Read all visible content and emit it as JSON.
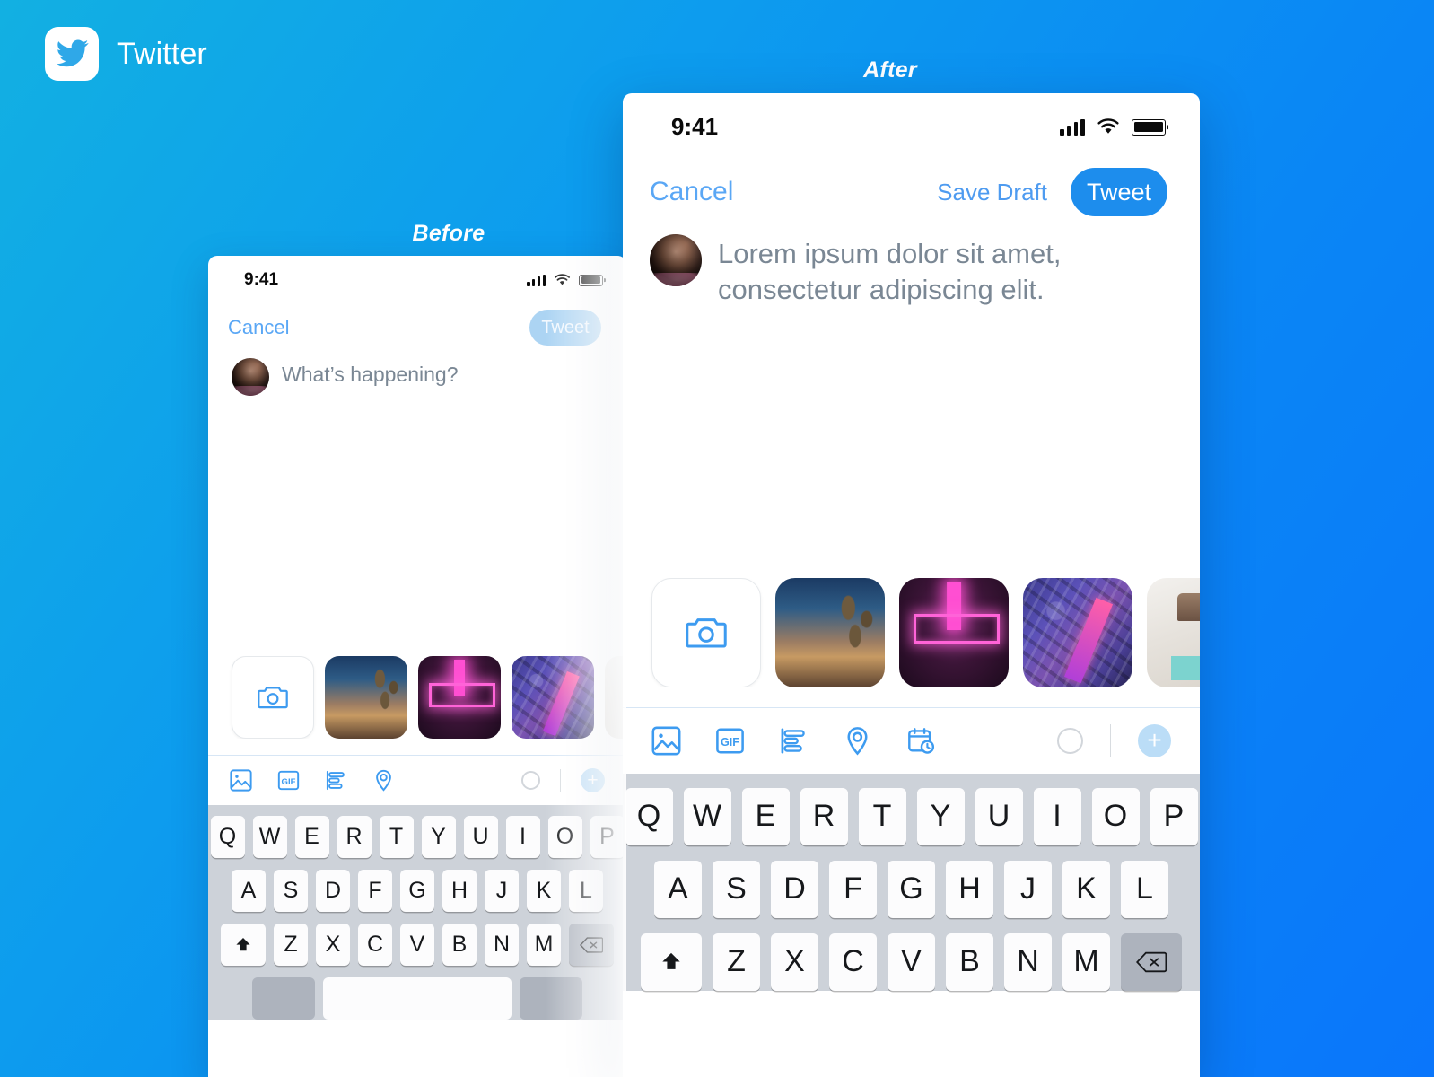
{
  "brand": {
    "name": "Twitter",
    "logo_icon": "twitter-bird-icon",
    "logo_bg": "#FFFFFF",
    "bird_color": "#2FA8E8"
  },
  "background": {
    "gradient_from": "#12B0E2",
    "gradient_to": "#0A76FB"
  },
  "captions": {
    "before": "Before",
    "after": "After"
  },
  "before": {
    "status_bar": {
      "time": "9:41",
      "signal_icon": "cellular-signal-icon",
      "wifi_icon": "wifi-icon",
      "battery_icon": "battery-icon"
    },
    "nav": {
      "cancel_label": "Cancel",
      "tweet_label": "Tweet",
      "tweet_enabled": false,
      "tweet_disabled_color": "#ACD4F3"
    },
    "compose": {
      "avatar_icon": "user-avatar",
      "placeholder": "What’s happening?"
    },
    "media": {
      "camera_icon": "camera-icon",
      "thumbnails": [
        "photo-teepee-desert",
        "photo-neon-portrait",
        "photo-aerial-city",
        "photo-white-lamp"
      ]
    },
    "toolbar": {
      "icons": [
        "image-icon",
        "gif-icon",
        "poll-icon",
        "location-icon"
      ],
      "gif_label": "GIF",
      "char_counter_icon": "character-count-circle",
      "add_label": "+"
    },
    "keyboard": {
      "row1": [
        "Q",
        "W",
        "E",
        "R",
        "T",
        "Y",
        "U",
        "I",
        "O",
        "P"
      ],
      "row2": [
        "A",
        "S",
        "D",
        "F",
        "G",
        "H",
        "J",
        "K",
        "L"
      ],
      "row3": [
        "Z",
        "X",
        "C",
        "V",
        "B",
        "N",
        "M"
      ],
      "shift_icon": "shift-icon",
      "delete_icon": "backspace-icon"
    }
  },
  "after": {
    "status_bar": {
      "time": "9:41",
      "signal_icon": "cellular-signal-icon",
      "wifi_icon": "wifi-icon",
      "battery_icon": "battery-icon"
    },
    "nav": {
      "cancel_label": "Cancel",
      "save_draft_label": "Save Draft",
      "tweet_label": "Tweet",
      "tweet_enabled": true,
      "tweet_active_color": "#1D8DED"
    },
    "compose": {
      "avatar_icon": "user-avatar",
      "text": "Lorem ipsum dolor sit amet, consectetur adipiscing elit."
    },
    "media": {
      "camera_icon": "camera-icon",
      "thumbnails": [
        "photo-teepee-desert",
        "photo-neon-portrait",
        "photo-aerial-city",
        "photo-white-lamp"
      ]
    },
    "toolbar": {
      "icons": [
        "image-icon",
        "gif-icon",
        "poll-icon",
        "location-icon",
        "schedule-icon"
      ],
      "gif_label": "GIF",
      "char_counter_icon": "character-count-circle",
      "add_label": "+"
    },
    "keyboard": {
      "row1": [
        "Q",
        "W",
        "E",
        "R",
        "T",
        "Y",
        "U",
        "I",
        "O",
        "P"
      ],
      "row2": [
        "A",
        "S",
        "D",
        "F",
        "G",
        "H",
        "J",
        "K",
        "L"
      ],
      "row3": [
        "Z",
        "X",
        "C",
        "V",
        "B",
        "N",
        "M"
      ],
      "shift_icon": "shift-icon",
      "delete_icon": "backspace-icon"
    }
  }
}
